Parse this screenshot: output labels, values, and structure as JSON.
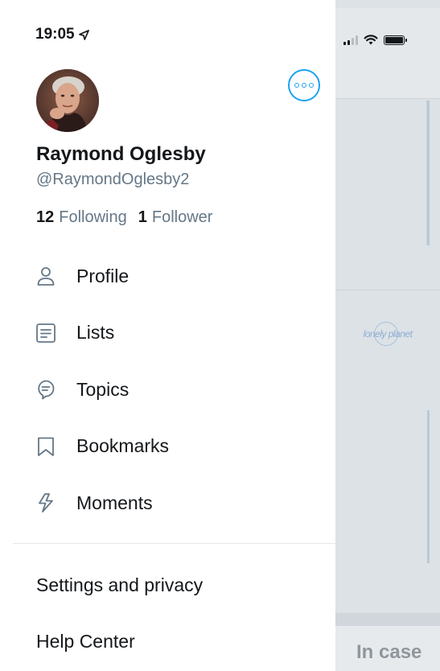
{
  "status_bar": {
    "time": "19:05"
  },
  "profile": {
    "name": "Raymond Oglesby",
    "handle": "@RaymondOglesby2",
    "following_count": "12",
    "following_label": "Following",
    "followers_count": "1",
    "followers_label": "Follower"
  },
  "menu": [
    {
      "label": "Profile",
      "icon": "person-icon"
    },
    {
      "label": "Lists",
      "icon": "list-icon"
    },
    {
      "label": "Topics",
      "icon": "topics-icon"
    },
    {
      "label": "Bookmarks",
      "icon": "bookmark-icon"
    },
    {
      "label": "Moments",
      "icon": "lightning-icon"
    }
  ],
  "secondary": {
    "settings": "Settings and privacy",
    "help": "Help Center"
  },
  "background": {
    "logo_text": "lonely planet",
    "bottom_text": "In case"
  },
  "colors": {
    "accent": "#1da1f2",
    "secondary_text": "#657786",
    "primary_text": "#14171a"
  }
}
